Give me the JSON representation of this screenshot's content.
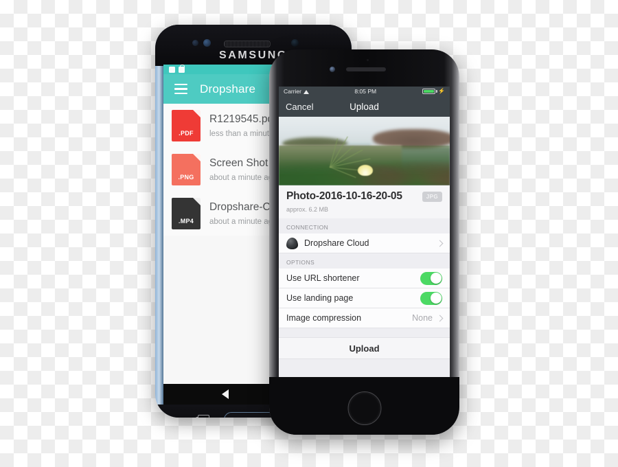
{
  "android": {
    "brand": "SAMSUNG",
    "statusbar": {
      "icons": [
        "notification-icon",
        "android-robot-icon"
      ]
    },
    "appbar": {
      "menu_icon": "hamburger-menu-icon",
      "title": "Dropshare"
    },
    "files": [
      {
        "ext": ".PDF",
        "name": "R1219545.pdf",
        "time": "less than a minute ago",
        "color": "#ef3b36"
      },
      {
        "ext": ".PNG",
        "name": "Screen Shot 2016-10-16",
        "time": "about a minute ago",
        "color": "#f4705f"
      },
      {
        "ext": ".MP4",
        "name": "Dropshare-Cloud-Demo.mp4",
        "time": "about a minute ago",
        "color": "#343434"
      }
    ],
    "navbar": {
      "back": "back-triangle-icon",
      "home": "home-circle-icon",
      "recents": "recents-icon"
    }
  },
  "ios": {
    "statusbar": {
      "carrier": "Carrier",
      "wifi": "wifi-icon",
      "time": "8:05 PM",
      "battery": "100",
      "charging": true
    },
    "navbar": {
      "cancel": "Cancel",
      "title": "Upload"
    },
    "photo": {
      "alt": "beach dune with ice plants and yellow flower"
    },
    "file": {
      "name": "Photo-2016-10-16-20-05",
      "badge": "JPG",
      "size": "approx. 6.2 MB"
    },
    "sections": [
      {
        "header": "CONNECTION",
        "rows": [
          {
            "type": "disclosure",
            "icon": "dropshare-droplet-icon",
            "label": "Dropshare Cloud",
            "value": ""
          }
        ]
      },
      {
        "header": "OPTIONS",
        "rows": [
          {
            "type": "toggle",
            "label": "Use URL shortener",
            "on": true
          },
          {
            "type": "toggle",
            "label": "Use landing page",
            "on": true
          },
          {
            "type": "disclosure",
            "label": "Image compression",
            "value": "None"
          }
        ]
      }
    ],
    "upload_button": "Upload"
  },
  "colors": {
    "android_accent": "#4ecbc2",
    "ios_navbar": "#3d4449",
    "toggle_on": "#4cd964",
    "pdf_red": "#ef3b36",
    "png_salmon": "#f4705f",
    "mp4_dark": "#343434"
  }
}
